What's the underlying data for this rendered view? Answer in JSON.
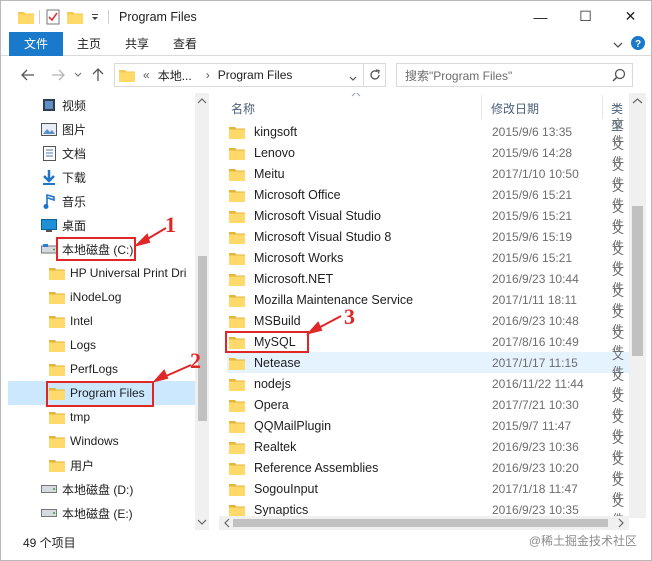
{
  "window": {
    "title": "Program Files"
  },
  "titlebar": {
    "minimize": "—",
    "maximize": "☐",
    "close": "✕"
  },
  "ribbon": {
    "tabs": [
      {
        "label": "文件",
        "active": true
      },
      {
        "label": "主页",
        "active": false
      },
      {
        "label": "共享",
        "active": false
      },
      {
        "label": "查看",
        "active": false
      }
    ]
  },
  "address": {
    "prefix": "«",
    "segments": [
      "本地...",
      "Program Files"
    ],
    "separator": "›",
    "search_placeholder": "搜索\"Program Files\""
  },
  "nav": {
    "items": [
      {
        "label": "视频",
        "icon": "video-icon"
      },
      {
        "label": "图片",
        "icon": "picture-icon"
      },
      {
        "label": "文档",
        "icon": "document-icon"
      },
      {
        "label": "下载",
        "icon": "download-icon"
      },
      {
        "label": "音乐",
        "icon": "music-icon"
      },
      {
        "label": "桌面",
        "icon": "desktop-icon"
      },
      {
        "label": "本地磁盘 (C:)",
        "icon": "drive-icon"
      },
      {
        "label": "HP Universal Print Dri",
        "icon": "folder-icon"
      },
      {
        "label": "iNodeLog",
        "icon": "folder-icon"
      },
      {
        "label": "Intel",
        "icon": "folder-icon"
      },
      {
        "label": "Logs",
        "icon": "folder-icon"
      },
      {
        "label": "PerfLogs",
        "icon": "folder-icon"
      },
      {
        "label": "Program Files",
        "icon": "folder-icon",
        "selected": true
      },
      {
        "label": "tmp",
        "icon": "folder-icon"
      },
      {
        "label": "Windows",
        "icon": "folder-icon"
      },
      {
        "label": "用户",
        "icon": "folder-icon"
      },
      {
        "label": "本地磁盘 (D:)",
        "icon": "drive-icon"
      },
      {
        "label": "本地磁盘 (E:)",
        "icon": "drive-icon"
      }
    ]
  },
  "files": {
    "columns": {
      "name": "名称",
      "date": "修改日期",
      "type": "类型"
    },
    "rows": [
      {
        "name": "kingsoft",
        "date": "2015/9/6 13:35",
        "type": "文件"
      },
      {
        "name": "Lenovo",
        "date": "2015/9/6 14:28",
        "type": "文件"
      },
      {
        "name": "Meitu",
        "date": "2017/1/10 10:50",
        "type": "文件"
      },
      {
        "name": "Microsoft Office",
        "date": "2015/9/6 15:21",
        "type": "文件"
      },
      {
        "name": "Microsoft Visual Studio",
        "date": "2015/9/6 15:21",
        "type": "文件"
      },
      {
        "name": "Microsoft Visual Studio 8",
        "date": "2015/9/6 15:19",
        "type": "文件"
      },
      {
        "name": "Microsoft Works",
        "date": "2015/9/6 15:21",
        "type": "文件"
      },
      {
        "name": "Microsoft.NET",
        "date": "2016/9/23 10:44",
        "type": "文件"
      },
      {
        "name": "Mozilla Maintenance Service",
        "date": "2017/1/11 18:11",
        "type": "文件"
      },
      {
        "name": "MSBuild",
        "date": "2016/9/23 10:48",
        "type": "文件"
      },
      {
        "name": "MySQL",
        "date": "2017/8/16 10:49",
        "type": "文件"
      },
      {
        "name": "Netease",
        "date": "2017/1/17 11:15",
        "type": "文件",
        "hover": true
      },
      {
        "name": "nodejs",
        "date": "2016/11/22 11:44",
        "type": "文件"
      },
      {
        "name": "Opera",
        "date": "2017/7/21 10:30",
        "type": "文件"
      },
      {
        "name": "QQMailPlugin",
        "date": "2015/9/7 11:47",
        "type": "文件"
      },
      {
        "name": "Realtek",
        "date": "2016/9/23 10:36",
        "type": "文件"
      },
      {
        "name": "Reference Assemblies",
        "date": "2016/9/23 10:20",
        "type": "文件"
      },
      {
        "name": "SogouInput",
        "date": "2017/1/18 11:47",
        "type": "文件"
      },
      {
        "name": "Synaptics",
        "date": "2016/9/23 10:35",
        "type": "文件"
      }
    ]
  },
  "status": {
    "count": "49 个项目"
  },
  "watermark": "@稀土掘金技术社区",
  "annotations": [
    "1",
    "2",
    "3"
  ],
  "colors": {
    "accent": "#1979ca",
    "annotation": "#e02626",
    "selected": "#cce8ff",
    "folder": "#f4c94e"
  }
}
